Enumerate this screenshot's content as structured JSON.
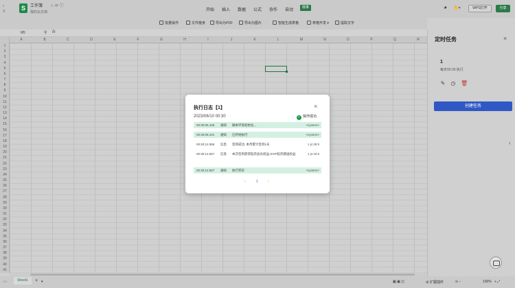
{
  "titlebar": {
    "app_icon": "S",
    "title": "工作簿",
    "subtitle": "我的云文档"
  },
  "menu": {
    "tabs": [
      "开始",
      "插入",
      "数据",
      "公式",
      "协作",
      "自动"
    ],
    "highlight_tab": "效率"
  },
  "topright": {
    "wps_label": "WPS打开",
    "share_label": "分享"
  },
  "ribbon": {
    "items": [
      "批量操作",
      "文件瘦身",
      "导出为PDF",
      "导出为图片",
      "智能生成表格",
      "表格开发",
      "提取文字"
    ]
  },
  "formula": {
    "cell_ref": "M5",
    "fx": "fx"
  },
  "columns": [
    "A",
    "B",
    "C",
    "D",
    "E",
    "F",
    "G",
    "H",
    "I",
    "J",
    "K",
    "L",
    "M",
    "N",
    "O",
    "P",
    "Q",
    "R"
  ],
  "rows": [
    "1",
    "2",
    "3",
    "4",
    "5",
    "6",
    "7",
    "8",
    "9",
    "10",
    "11",
    "12",
    "13",
    "14",
    "15",
    "16",
    "17",
    "18",
    "19",
    "20",
    "21",
    "22",
    "23",
    "24",
    "25",
    "26",
    "27",
    "28",
    "29",
    "30",
    "31",
    "32",
    "33",
    "34",
    "35",
    "36",
    "37",
    "38",
    "39",
    "40",
    "41"
  ],
  "sheet": {
    "name": "Sheet1",
    "add": "+",
    "zoom": "100%"
  },
  "statusbar": {
    "expand_label": "扩展插件"
  },
  "side_panel": {
    "title": "定时任务",
    "close": "×",
    "task_number": "1",
    "task_schedule": "每天00:30 执行",
    "create_button": "创建任务"
  },
  "modal": {
    "title": "执行日志【1】",
    "close": "×",
    "datetime": "2023/06/10 00:30",
    "status_icon": "✓",
    "status": "操作成功",
    "logs": [
      {
        "time": "00:30:06.448",
        "level": "通知",
        "message": "脚本环境初始化...",
        "source": "<system>"
      },
      {
        "time": "00:30:09.101",
        "level": "通知",
        "message": "已开始执行",
        "source": "<system>"
      },
      {
        "time": "00:30:12.556",
        "level": "信息",
        "message": "签到成功, 本月累计签到1天",
        "source": "1.js:39:9"
      },
      {
        "time": "00:30:12.557",
        "level": "信息",
        "message": "本次签到获得稻壳会员权益,SVIP稻壳赠送权益",
        "source": "1.js:40:9"
      },
      {
        "time": "00:30:12.557",
        "level": "通知",
        "message": "执行完毕",
        "source": "<system>"
      }
    ],
    "pager": {
      "prev": "‹",
      "page": "1",
      "next": "›"
    }
  },
  "colors": {
    "accent_green": "#2b7a48",
    "primary_blue": "#2f58c5",
    "success_green": "#1e9a48",
    "log_highlight": "#d4f0e2"
  }
}
